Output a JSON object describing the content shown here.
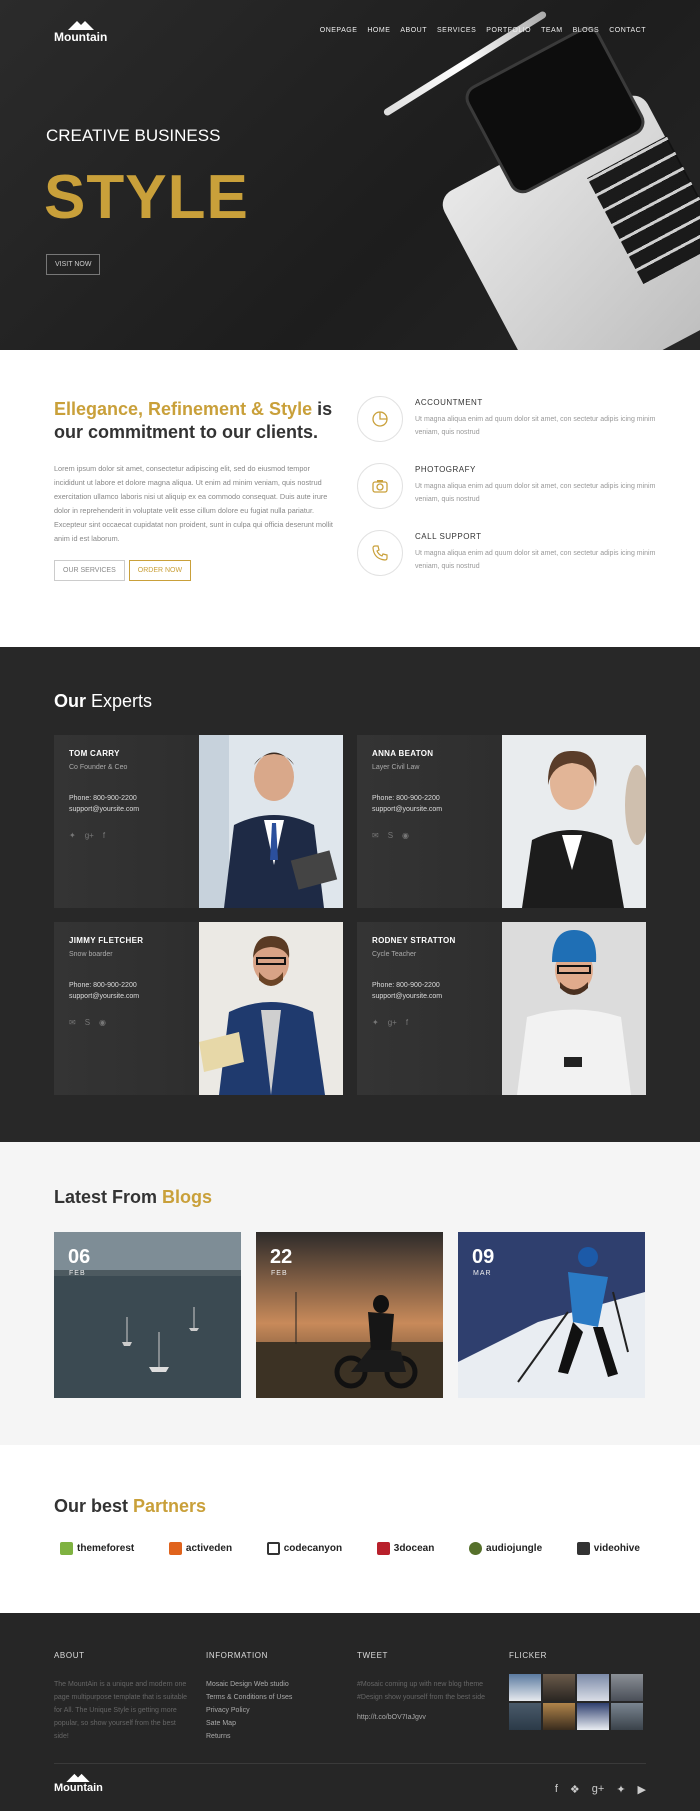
{
  "brand": {
    "name": "Mountain"
  },
  "nav": [
    "ONEPAGE",
    "HOME",
    "ABOUT",
    "SERVICES",
    "PORTFOLIO",
    "TEAM",
    "BLOGS",
    "CONTACT"
  ],
  "hero": {
    "subtitle": "CREATIVE BUSINESS",
    "title": "STYLE",
    "button": "VISIT NOW"
  },
  "about": {
    "heading_gold": "Ellegance, Refinement & Style",
    "heading_rest": " is our commitment to our clients.",
    "text": "Lorem ipsum dolor sit amet, consectetur adipiscing elit, sed do eiusmod tempor incididunt ut labore et dolore magna aliqua. Ut enim ad minim veniam, quis nostrud exercitation ullamco laboris nisi ut aliquip ex ea commodo consequat. Duis aute irure dolor in reprehenderit in voluptate velit esse cillum dolore eu fugiat nulla pariatur. Excepteur sint occaecat cupidatat non proident, sunt in culpa qui officia deserunt mollit anim id est laborum.",
    "btn_services": "OUR SERVICES",
    "btn_order": "ORDER NOW",
    "services": [
      {
        "title": "ACCOUNTMENT",
        "text": "Ut magna aliqua enim ad quum dolor sit amet, con sectetur adipis icing minim veniam, quis nostrud",
        "icon": "pie-chart-icon"
      },
      {
        "title": "PHOTOGRAFY",
        "text": "Ut magna aliqua enim ad quum dolor sit amet, con sectetur adipis icing minim veniam, quis nostrud",
        "icon": "camera-icon"
      },
      {
        "title": "CALL SUPPORT",
        "text": "Ut magna aliqua enim ad quum dolor sit amet, con sectetur adipis icing minim veniam, quis nostrud",
        "icon": "phone-icon"
      }
    ]
  },
  "experts": {
    "title_a": "Our ",
    "title_b": "Experts",
    "people": [
      {
        "name": "TOM CARRY",
        "role": "Co Founder & Ceo",
        "phone": "Phone: 800-900-2200",
        "email": "support@yoursite.com"
      },
      {
        "name": "ANNA BEATON",
        "role": "Layer Civil Law",
        "phone": "Phone: 800-900-2200",
        "email": "support@yoursite.com"
      },
      {
        "name": "JIMMY FLETCHER",
        "role": "Snow boarder",
        "phone": "Phone: 800-900-2200",
        "email": "support@yoursite.com"
      },
      {
        "name": "RODNEY STRATTON",
        "role": "Cycle Teacher",
        "phone": "Phone: 800-900-2200",
        "email": "support@yoursite.com"
      }
    ]
  },
  "blogs": {
    "title_a": "Latest From ",
    "title_b": "Blogs",
    "posts": [
      {
        "day": "06",
        "month": "FEB"
      },
      {
        "day": "22",
        "month": "FEB"
      },
      {
        "day": "09",
        "month": "MAR"
      }
    ]
  },
  "partners": {
    "title_a": "Our best ",
    "title_b": "Partners",
    "items": [
      "themeforest",
      "activeden",
      "codecanyon",
      "3docean",
      "audiojungle",
      "videohive"
    ]
  },
  "footer": {
    "about_head": "ABOUT",
    "about_text": "The MountAin is a unique and modern one page multipurpose template that is suitable for All. The Unique Style is getting more popular, so show yourself from the best side!",
    "info_head": "INFORMATION",
    "info_links": [
      "Mosaic Design Web studio",
      "Terms & Conditions of Uses",
      "Privacy Policy",
      "Sate Map",
      "Returns"
    ],
    "tweet_head": "TWEET",
    "tweet_text": "#Mosaic coming up with new blog theme #Design show yourself from the best side",
    "tweet_link": "http://t.co/bOV7IaJgvv",
    "flicker_head": "FLICKER",
    "brand": "Mountain"
  },
  "colors": {
    "gold": "#c9a03a",
    "dark": "#282828",
    "footer": "#262626"
  }
}
